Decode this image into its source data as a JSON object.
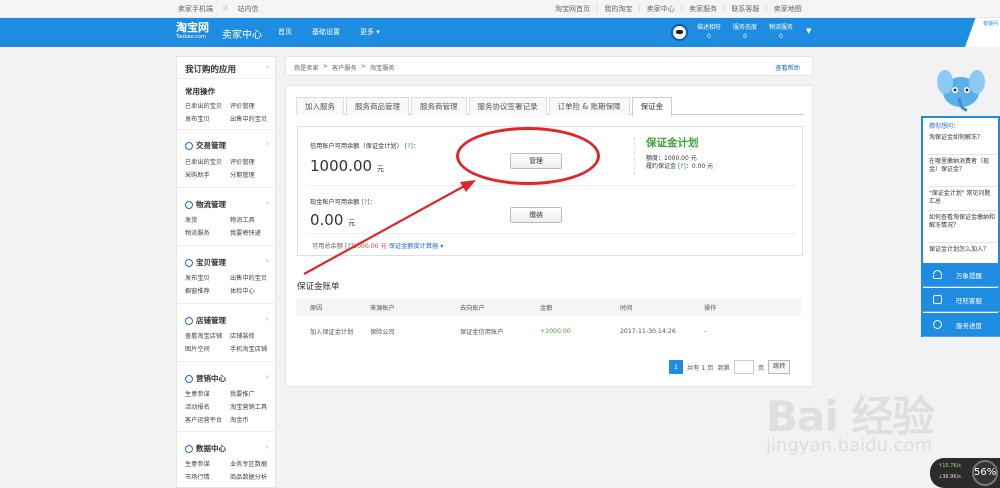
{
  "topbar": {
    "phone_link": "卖家手机端",
    "masked_user": "d",
    "messages": "站内信",
    "links": [
      "淘宝网首页",
      "我的淘宝",
      "卖家中心",
      "卖家服务",
      "联系客服",
      "卖家地图"
    ]
  },
  "header": {
    "logo_text": "淘宝网",
    "logo_sub": "Taobao.com",
    "title": "卖家中心",
    "nav": [
      "首页",
      "基础设置",
      "更多"
    ],
    "stats": [
      {
        "label": "描述相符",
        "value": "0"
      },
      {
        "label": "服务态度",
        "value": "0"
      },
      {
        "label": "物流服务",
        "value": "0"
      }
    ],
    "corner_text": "有疑问"
  },
  "sidebar": {
    "title": "我订购的应用",
    "common_title": "常用操作",
    "common_links": [
      "已卖出的宝贝",
      "评价管理",
      "发布宝贝",
      "出售中的宝贝"
    ],
    "sections": [
      {
        "title": "交易管理",
        "links": [
          "已卖出的宝贝",
          "评价管理",
          "采购助手",
          "分期管理"
        ]
      },
      {
        "title": "物流管理",
        "links": [
          "发货",
          "物流工具",
          "物流服务",
          "我要寄快递"
        ]
      },
      {
        "title": "宝贝管理",
        "links": [
          "发布宝贝",
          "出售中的宝贝",
          "橱窗推荐",
          "体检中心"
        ]
      },
      {
        "title": "店铺管理",
        "links": [
          "查看淘宝店铺",
          "店铺装修",
          "图片空间",
          "手机淘宝店铺"
        ]
      },
      {
        "title": "营销中心",
        "links": [
          "生意参谋",
          "我要推广",
          "活动报名",
          "淘宝营销工具",
          "客户运营平台",
          "淘金币"
        ]
      },
      {
        "title": "数据中心",
        "links": [
          "生意参谋",
          "业务专区数据",
          "市场行情",
          "商品数据分析"
        ]
      }
    ]
  },
  "breadcrumb": {
    "items": [
      "我是卖家",
      "客户服务",
      "淘宝服务"
    ],
    "help": "查看帮助"
  },
  "tabs": [
    "加入服务",
    "服务商品管理",
    "服务商管理",
    "服务协议签署记录",
    "订单险 & 账期保障",
    "保证金"
  ],
  "deposit": {
    "credit_label": "信用账户可用余额（保证金计划）",
    "help_mark": "[?]",
    "credit_amount": "1000.00",
    "unit": "元",
    "manage_button": "管理",
    "cash_label": "现金账户可用余额",
    "cash_amount": "0.00",
    "pay_button": "缴纳",
    "plan_logo": "保证金计划",
    "plan_quota": "额度：1000.00 元",
    "plan_fulfill_prefix": "履约保证金",
    "plan_fulfill_suffix": "：0.00 元",
    "avail_prefix": "可用总余额",
    "avail_amount": "1000.00 元",
    "calc_link": "保证金额度计算器"
  },
  "ledger": {
    "title": "保证金账单",
    "headers": [
      "原因",
      "来源账户",
      "去向账户",
      "金额",
      "时间",
      "操作"
    ],
    "rows": [
      [
        "加入保证金计划",
        "保险公司",
        "保证金信用账户",
        "+1000.00",
        "2017-11-30 14:26",
        "-"
      ]
    ]
  },
  "pager": {
    "current": "1",
    "total": "共有 1 页",
    "goto": "到第",
    "page_unit": "页",
    "jump": "跳转"
  },
  "help_panel": {
    "title": "猜你想问：",
    "questions": [
      "淘保证金如何解冻？",
      "在哪里缴纳消费者（现金）保证金？",
      "\"保证金计划\" 常见问题汇总",
      "如何查看淘保证金缴纳和解冻情况？",
      "保证金计划怎么加入？"
    ],
    "actions": [
      "万象提醒",
      "旺旺客服",
      "服务进度"
    ]
  },
  "watermark": {
    "big": "Bai 经验",
    "sub": "jingyan.baidu.com"
  },
  "speed": {
    "up": "↑15.7K/s",
    "down": "↓36.9K/s",
    "percent": "56%"
  },
  "colors": {
    "brand_blue": "#1e8ce0",
    "annotation_red": "#e0262a",
    "plan_green": "#3aa33a"
  }
}
